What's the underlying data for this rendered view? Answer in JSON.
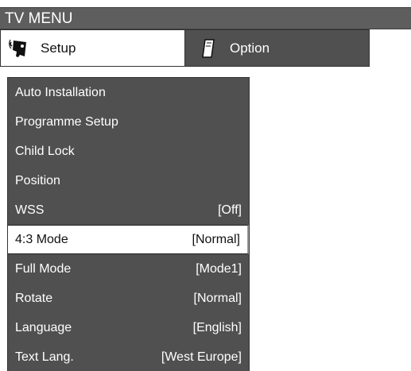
{
  "title": "TV MENU",
  "tabs": [
    {
      "label": "Setup",
      "icon": "setup-icon",
      "active": true
    },
    {
      "label": "Option",
      "icon": "option-icon",
      "active": false
    }
  ],
  "menu": {
    "items": [
      {
        "label": "Auto Installation",
        "value": ""
      },
      {
        "label": "Programme Setup",
        "value": ""
      },
      {
        "label": "Child Lock",
        "value": ""
      },
      {
        "label": "Position",
        "value": ""
      },
      {
        "label": "WSS",
        "value": "[Off]"
      },
      {
        "label": "4:3 Mode",
        "value": "[Normal]"
      },
      {
        "label": "Full Mode",
        "value": "[Mode1]"
      },
      {
        "label": "Rotate",
        "value": "[Normal]"
      },
      {
        "label": "Language",
        "value": "[English]"
      },
      {
        "label": "Text Lang.",
        "value": "[West Europe]"
      }
    ],
    "selected_index": 5
  },
  "colors": {
    "panel": "#505050",
    "title_bar": "#5e5e5e",
    "selected_bg": "#ffffff",
    "text_on_panel": "#ffffff"
  }
}
